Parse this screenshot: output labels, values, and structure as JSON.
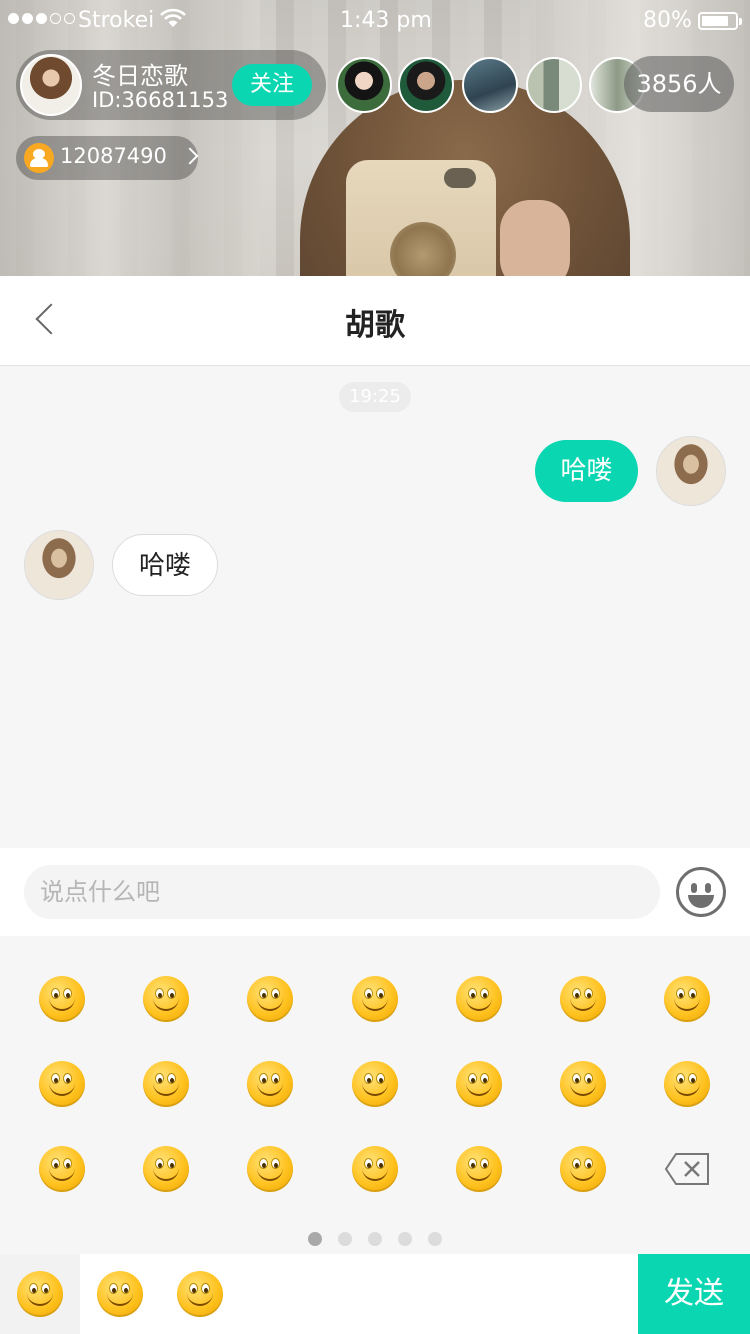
{
  "status_bar": {
    "carrier": "Strokei",
    "time": "1:43 pm",
    "battery_text": "80%",
    "battery_level": 0.8
  },
  "live": {
    "host_name": "冬日恋歌",
    "host_id": "ID:36681153",
    "follow_label": "关注",
    "viewer_count": "3856人",
    "coin_value": "12087490"
  },
  "nav": {
    "title": "胡歌"
  },
  "chat": {
    "timestamp": "19:25",
    "messages": [
      {
        "side": "self",
        "text": "哈喽"
      },
      {
        "side": "other",
        "text": "哈喽"
      }
    ]
  },
  "composer": {
    "placeholder": "说点什么吧",
    "emoji_grid": {
      "rows": 3,
      "cols": 7,
      "icon": "smiley-emoji-icon",
      "last_cell_icon": "backspace-icon"
    },
    "page_dots": 5,
    "active_page": 1,
    "categories": [
      "smiley-emoji-icon",
      "smiley-emoji-icon",
      "smiley-emoji-icon"
    ],
    "send_label": "发送"
  },
  "colors": {
    "accent": "#0ad6b2",
    "coin": "#f8a821"
  }
}
